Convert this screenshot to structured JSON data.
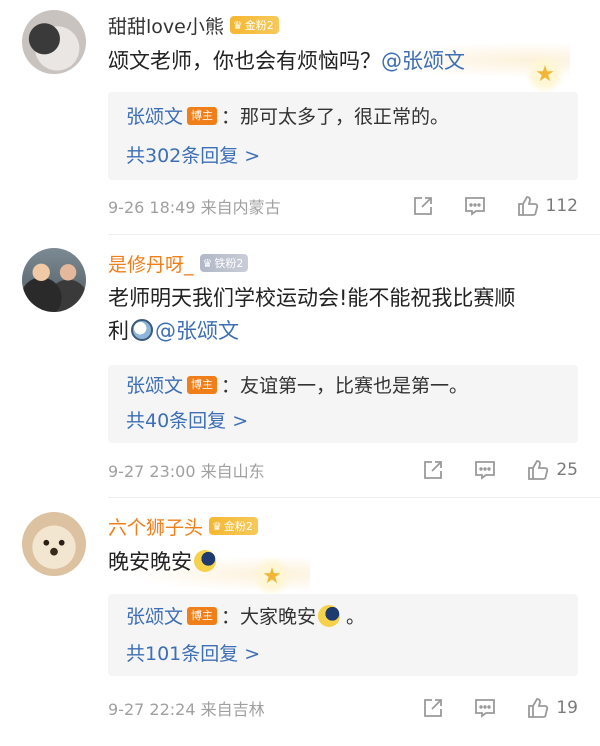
{
  "comments": [
    {
      "username": "甜甜love小熊",
      "badge": "金粉2",
      "text": "颂文老师，你也会有烦恼吗？",
      "mention": "@张颂文",
      "reply": {
        "name": "张颂文",
        "tag": "博主",
        "text": "：那可太多了，很正常的。"
      },
      "reply_count": "共302条回复 >",
      "time": "9-26 18:49",
      "location": "来自内蒙古",
      "likes": "112"
    },
    {
      "username": "是修丹呀_",
      "badge": "铁粉2",
      "text_line1": "老师明天我们学校运动会!能不能祝我比赛顺",
      "text_line2": "利",
      "mention": "@张颂文",
      "reply": {
        "name": "张颂文",
        "tag": "博主",
        "text": "：友谊第一，比赛也是第一。"
      },
      "reply_count": "共40条回复 >",
      "time": "9-27 23:00",
      "location": "来自山东",
      "likes": "25"
    },
    {
      "username": "六个狮子头",
      "badge": "金粉2",
      "text": "晚安晚安",
      "reply": {
        "name": "张颂文",
        "tag": "博主",
        "text": "：大家晚安",
        "suffix": "。"
      },
      "reply_count": "共101条回复 >",
      "time": "9-27 22:24",
      "location": "来自吉林",
      "likes": "19"
    }
  ],
  "icons": {
    "share": "share-icon",
    "comment": "comment-icon",
    "like": "thumbs-up-icon",
    "star": "star-icon",
    "badge_crown": "crown-icon"
  },
  "colors": {
    "link": "#3d6fb6",
    "host_tag": "#f07f1a",
    "gold_badge": "#f5b732",
    "iron_badge": "#b1b7c6",
    "meta": "#a0a0a0"
  }
}
